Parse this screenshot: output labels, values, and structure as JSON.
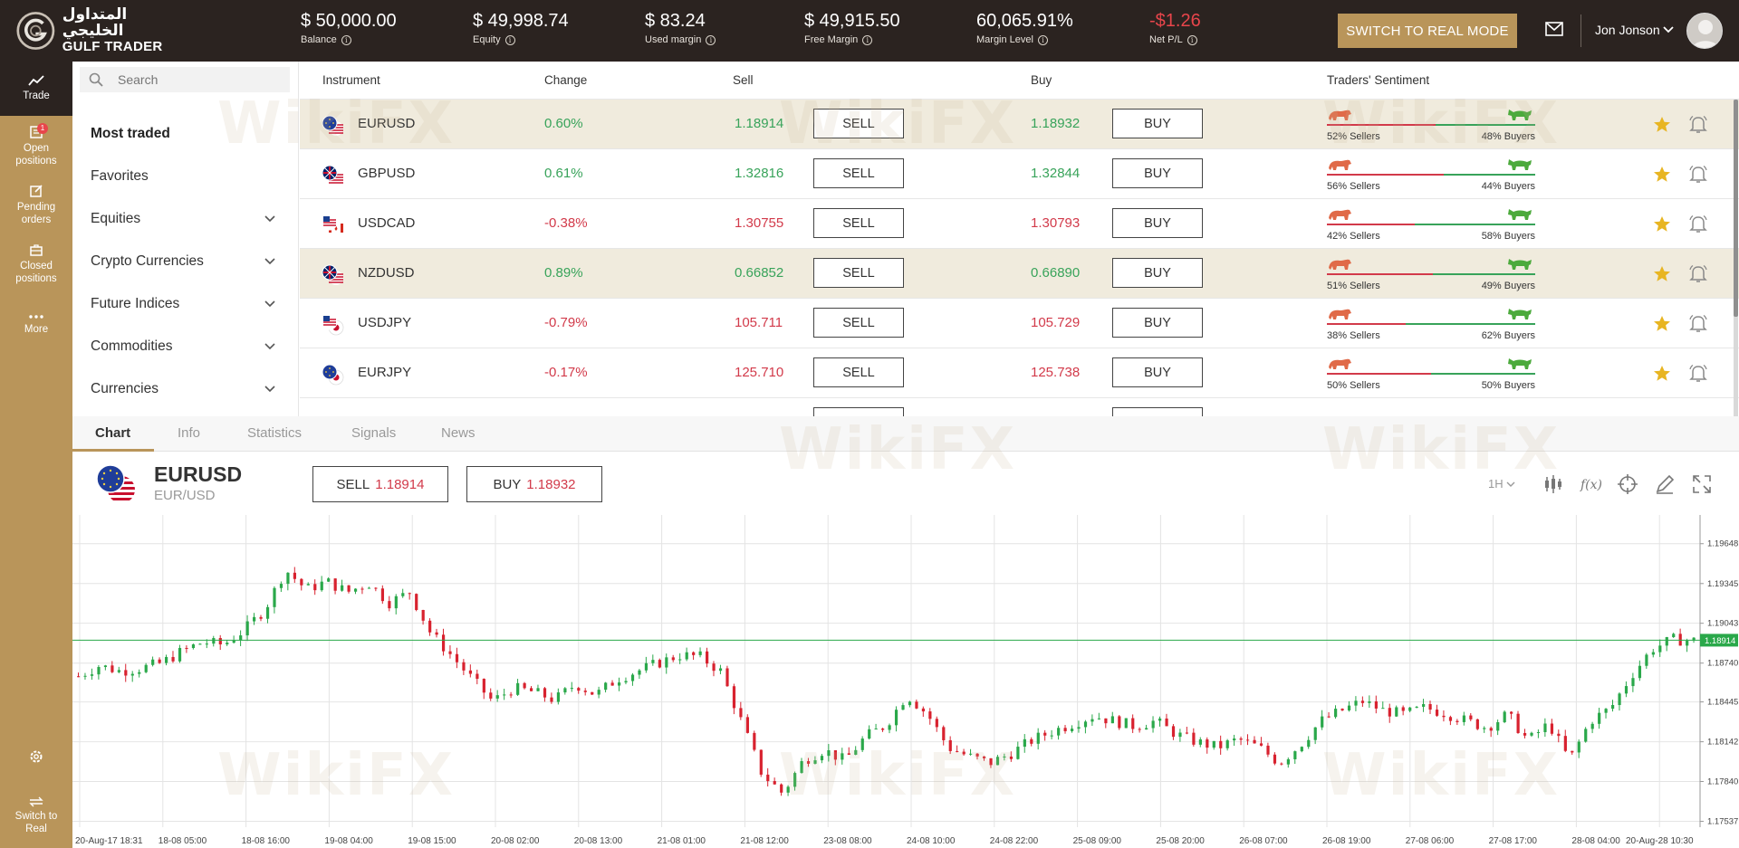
{
  "brand": {
    "arabic": "المتداول الخليجي",
    "english": "GULF TRADER"
  },
  "stats": [
    {
      "value": "$ 50,000.00",
      "label": "Balance"
    },
    {
      "value": "$ 49,998.74",
      "label": "Equity"
    },
    {
      "value": "$ 83.24",
      "label": "Used margin"
    },
    {
      "value": "$ 49,915.50",
      "label": "Free Margin"
    },
    {
      "value": "60,065.91%",
      "label": "Margin Level"
    },
    {
      "value": "-$1.26",
      "label": "Net P/L"
    }
  ],
  "header": {
    "real_mode_label": "SWITCH TO REAL MODE",
    "user_name": "Jon Jonson"
  },
  "rail": {
    "trade": "Trade",
    "open_line1": "Open",
    "open_line2": "positions",
    "open_badge": "1",
    "pending_line1": "Pending",
    "pending_line2": "orders",
    "closed_line1": "Closed",
    "closed_line2": "positions",
    "more": "More",
    "switch_line1": "Switch to",
    "switch_line2": "Real"
  },
  "search": {
    "placeholder": "Search"
  },
  "categories": [
    {
      "label": "Most traded"
    },
    {
      "label": "Favorites"
    },
    {
      "label": "Equities"
    },
    {
      "label": "Crypto Currencies"
    },
    {
      "label": "Future Indices"
    },
    {
      "label": "Commodities"
    },
    {
      "label": "Currencies"
    }
  ],
  "table": {
    "headers": {
      "instrument": "Instrument",
      "change": "Change",
      "sell": "Sell",
      "buy": "Buy",
      "sentiment": "Traders' Sentiment"
    },
    "sell_label": "SELL",
    "buy_label": "BUY",
    "rows": [
      {
        "symbol": "EURUSD",
        "change": "0.60%",
        "sell": "1.18914",
        "buy": "1.18932",
        "sellers": "52% Sellers",
        "buyers": "48% Buyers",
        "sellers_pct": 52
      },
      {
        "symbol": "GBPUSD",
        "change": "0.61%",
        "sell": "1.32816",
        "buy": "1.32844",
        "sellers": "56% Sellers",
        "buyers": "44% Buyers",
        "sellers_pct": 56
      },
      {
        "symbol": "USDCAD",
        "change": "-0.38%",
        "sell": "1.30755",
        "buy": "1.30793",
        "sellers": "42% Sellers",
        "buyers": "58% Buyers",
        "sellers_pct": 42
      },
      {
        "symbol": "NZDUSD",
        "change": "0.89%",
        "sell": "0.66852",
        "buy": "0.66890",
        "sellers": "51% Sellers",
        "buyers": "49% Buyers",
        "sellers_pct": 51
      },
      {
        "symbol": "USDJPY",
        "change": "-0.79%",
        "sell": "105.711",
        "buy": "105.729",
        "sellers": "38% Sellers",
        "buyers": "62% Buyers",
        "sellers_pct": 38
      },
      {
        "symbol": "EURJPY",
        "change": "-0.17%",
        "sell": "125.710",
        "buy": "125.738",
        "sellers": "50% Sellers",
        "buyers": "50% Buyers",
        "sellers_pct": 50
      }
    ]
  },
  "tabs": [
    "Chart",
    "Info",
    "Statistics",
    "Signals",
    "News"
  ],
  "chart_header": {
    "symbol": "EURUSD",
    "pair": "EUR/USD",
    "sell_label": "SELL",
    "sell_price": "1.18914",
    "buy_label": "BUY",
    "buy_price": "1.18932",
    "timeframe": "1H"
  },
  "watermark": "WikiFX",
  "colors": {
    "accent": "#b9955a",
    "topbar": "#2b2320",
    "up": "#38a35a",
    "down": "#d23a4a",
    "highlight": "#f0ebdd"
  },
  "chart_data": {
    "type": "candlestick",
    "y_ticks": [
      "1.19648",
      "1.19345",
      "1.19043",
      "1.18740",
      "1.18445",
      "1.18142",
      "1.17840",
      "1.17537"
    ],
    "ylim": [
      1.1752,
      1.1966
    ],
    "current_price": "1.18914",
    "x_ticks": [
      "20-Aug-17 18:31",
      "18-08 05:00",
      "18-08 16:00",
      "19-08 04:00",
      "19-08 15:00",
      "20-08 02:00",
      "20-08 13:00",
      "21-08 01:00",
      "21-08 12:00",
      "23-08 08:00",
      "24-08 10:00",
      "24-08 22:00",
      "25-08 09:00",
      "25-08 20:00",
      "26-08 07:00",
      "26-08 19:00",
      "27-08 06:00",
      "27-08 17:00",
      "28-08 04:00",
      "20-Aug-28 10:30"
    ],
    "close_path": [
      1.1864,
      1.1872,
      1.1868,
      1.187,
      1.1874,
      1.1883,
      1.189,
      1.1888,
      1.1899,
      1.1915,
      1.1945,
      1.193,
      1.1936,
      1.1928,
      1.1935,
      1.192,
      1.1928,
      1.1897,
      1.188,
      1.1862,
      1.1845,
      1.1855,
      1.1852,
      1.1846,
      1.1858,
      1.185,
      1.1862,
      1.1868,
      1.1874,
      1.188,
      1.1879,
      1.1868,
      1.183,
      1.179,
      1.1775,
      1.18,
      1.1808,
      1.18,
      1.1818,
      1.1827,
      1.185,
      1.1835,
      1.181,
      1.1803,
      1.1798,
      1.1805,
      1.1815,
      1.1822,
      1.1828,
      1.1834,
      1.183,
      1.1826,
      1.183,
      1.182,
      1.1814,
      1.181,
      1.1816,
      1.181,
      1.1798,
      1.1812,
      1.183,
      1.1838,
      1.1845,
      1.1838,
      1.1835,
      1.184,
      1.1836,
      1.183,
      1.1825,
      1.1835,
      1.1815,
      1.1828,
      1.18,
      1.183,
      1.184,
      1.1865,
      1.1885,
      1.1892,
      1.1891
    ]
  }
}
